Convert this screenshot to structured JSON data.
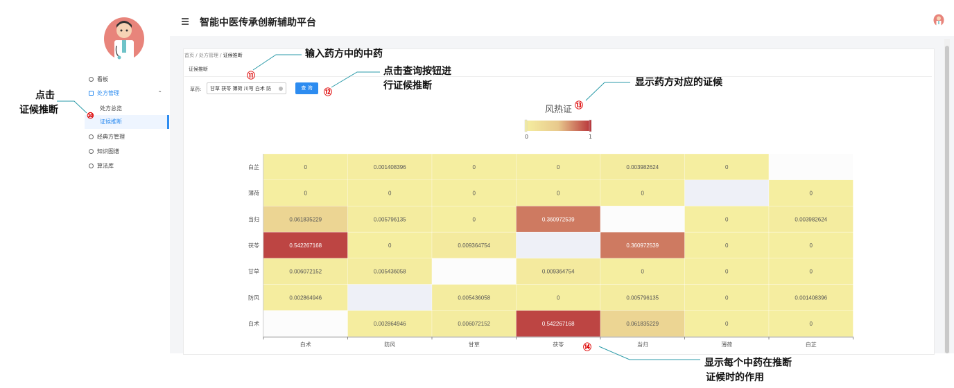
{
  "header": {
    "title": "智能中医传承创新辅助平台"
  },
  "sidebar": {
    "items": [
      {
        "label": "看板"
      },
      {
        "label": "处方管理"
      },
      {
        "label": "经典方管理"
      },
      {
        "label": "知识图谱"
      },
      {
        "label": "算法库"
      }
    ],
    "submenu": [
      {
        "label": "处方总览"
      },
      {
        "label": "证候推断"
      }
    ]
  },
  "breadcrumb": {
    "home": "首页",
    "sep": "/",
    "level2": "处方管理",
    "current": "证候推断"
  },
  "card": {
    "title": "证候推断"
  },
  "form": {
    "label": "草药:",
    "value": "甘草 茯苓 薄荷 川芎 白术 防",
    "button": "查 询"
  },
  "annotations": {
    "a10_mark": "⑩",
    "a10_line1": "点击",
    "a10_line2": "证候推断",
    "a11_mark": "⑪",
    "a11_text": "输入药方中的中药",
    "a12_mark": "⑫",
    "a12_line1": "点击查询按钮进",
    "a12_line2": "行证候推断",
    "a13_mark": "⑬",
    "a13_text": "显示药方对应的证候",
    "a14_mark": "⑭",
    "a14_line1": "显示每个中药在推断",
    "a14_line2": "证候时的作用"
  },
  "chart_data": {
    "type": "heatmap",
    "title": "风热证",
    "colorbar": {
      "min": "0",
      "max": "1",
      "colors": [
        "#f5eea0",
        "#e8c98d",
        "#b8343a"
      ]
    },
    "x_categories": [
      "白术",
      "防风",
      "甘草",
      "茯苓",
      "当归",
      "薄荷",
      "白芷"
    ],
    "y_categories": [
      "白芷",
      "薄荷",
      "当归",
      "茯苓",
      "甘草",
      "防风",
      "白术"
    ],
    "cells": [
      [
        "0",
        "0.001408396",
        "0",
        "0",
        "0.003982624",
        "0",
        null
      ],
      [
        "0",
        "0",
        "0",
        "0",
        "0",
        null,
        "0"
      ],
      [
        "0.061835229",
        "0.005796135",
        "0",
        "0.360972539",
        null,
        "0",
        "0.003982624"
      ],
      [
        "0.542267168",
        "0",
        "0.009364754",
        null,
        "0.360972539",
        "0",
        "0"
      ],
      [
        "0.006072152",
        "0.005436058",
        null,
        "0.009364754",
        "0",
        "0",
        "0"
      ],
      [
        "0.002864946",
        null,
        "0.005436058",
        "0",
        "0.005796135",
        "0",
        "0.001408396"
      ],
      [
        null,
        "0.002864946",
        "0.006072152",
        "0.542267168",
        "0.061835229",
        "0",
        "0"
      ]
    ]
  }
}
